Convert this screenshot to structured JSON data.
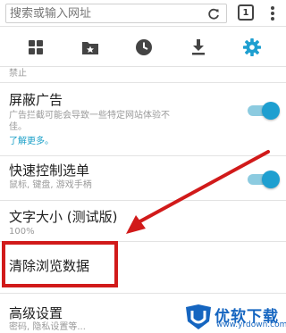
{
  "search": {
    "placeholder": "搜索或输入网址",
    "tab_count": "1"
  },
  "toolbar": {
    "items": [
      {
        "icon": "grid-icon"
      },
      {
        "icon": "bookmark-folder-icon"
      },
      {
        "icon": "history-clock-icon"
      },
      {
        "icon": "download-icon"
      },
      {
        "icon": "settings-gear-icon",
        "active": true
      }
    ]
  },
  "settings": {
    "prev_tail": "禁止",
    "adblock": {
      "title": "屏蔽广告",
      "desc_line1": "广告拦截可能会导致一些特定网站体验不",
      "desc_line2": "佳。",
      "link": "了解更多。",
      "enabled": true
    },
    "quick_control": {
      "title": "快速控制选单",
      "desc": "鼠标, 键盘, 游戏手柄",
      "enabled": true
    },
    "text_size": {
      "title": "文字大小 (测试版)",
      "value": "100%"
    },
    "clear_data": {
      "title": "清除浏览数据"
    },
    "advanced": {
      "title": "高级设置",
      "desc": "密码, 隐私设置等..."
    }
  },
  "watermark": {
    "name": "优软下载",
    "url": "www.yrdown.com"
  },
  "colors": {
    "accent": "#1e9fd0",
    "highlight": "#d11a1a"
  }
}
